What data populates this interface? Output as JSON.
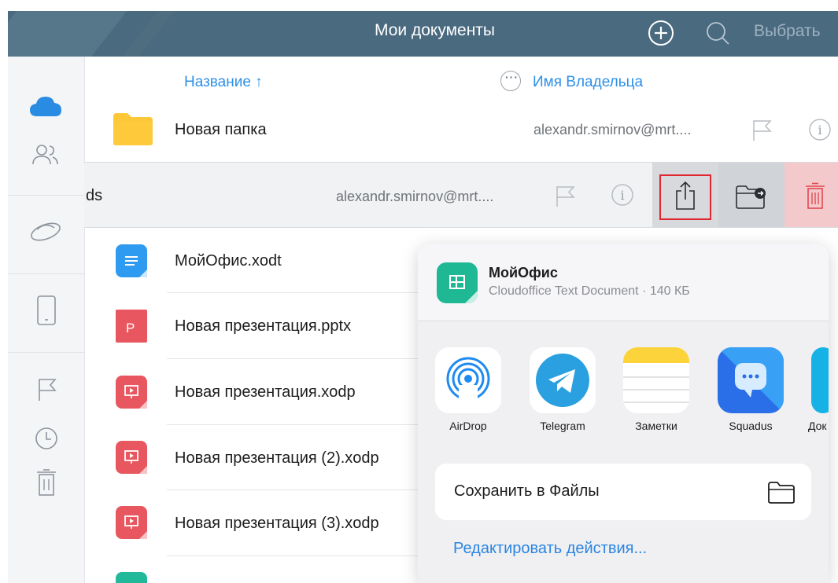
{
  "header": {
    "title": "Мои документы",
    "select_label": "Выбрать"
  },
  "sort": {
    "name_label": "Название ↑",
    "owner_label": "Имя Владельца"
  },
  "rows": [
    {
      "name": "Новая папка",
      "owner": "alexandr.smirnov@mrt...."
    },
    {
      "name": "ds",
      "owner": "alexandr.smirnov@mrt...."
    },
    {
      "name": "МойОфис.xodt"
    },
    {
      "name": "Новая презентация.pptx"
    },
    {
      "name": "Новая презентация.xodp"
    },
    {
      "name": "Новая презентация (2).xodp"
    },
    {
      "name": "Новая презентация (3).xodp"
    }
  ],
  "sheet": {
    "app_name": "МойОфис",
    "file_info": "Cloudoffice Text Document · 140 КБ",
    "apps": [
      {
        "label": "AirDrop"
      },
      {
        "label": "Telegram"
      },
      {
        "label": "Заметки"
      },
      {
        "label": "Squadus"
      },
      {
        "label": "Док"
      }
    ],
    "save_files_label": "Сохранить в Файлы",
    "edit_actions_label": "Редактировать действия..."
  },
  "colors": {
    "header_bg": "#4a6a80",
    "accent_blue": "#2e90e6",
    "highlight_red": "#e0262f",
    "folder_yellow": "#fdc837"
  }
}
